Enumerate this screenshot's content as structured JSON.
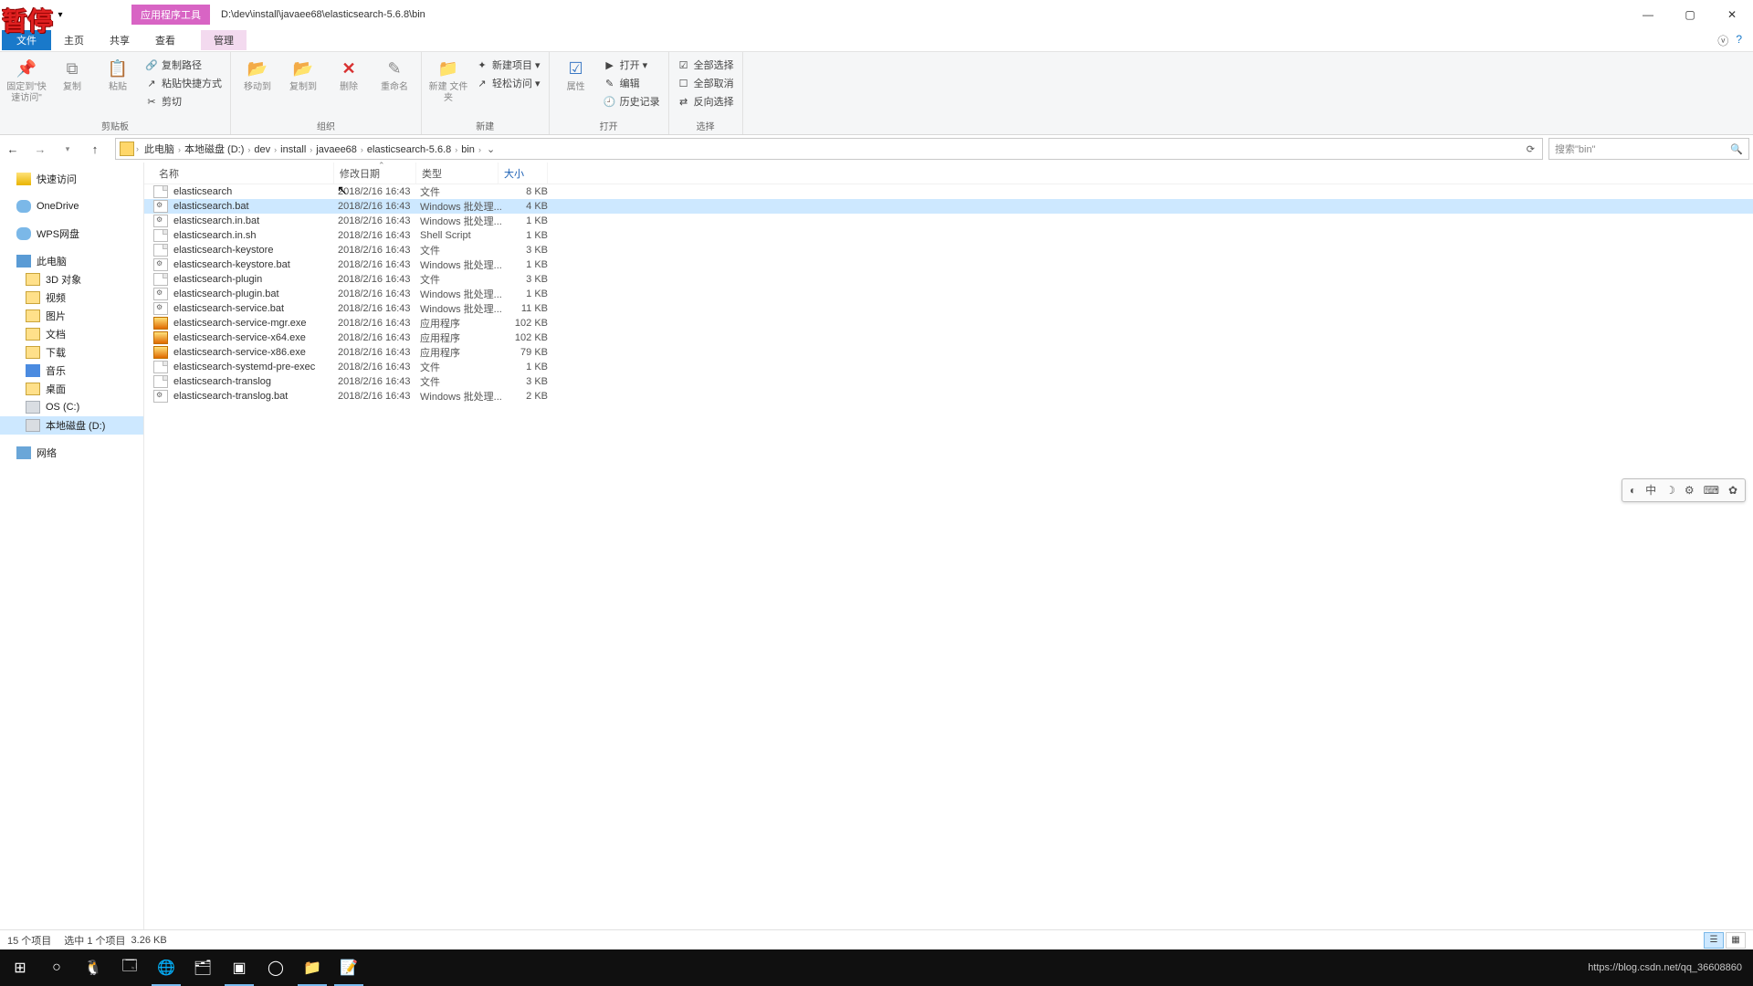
{
  "watermark": "暂停",
  "title_path": "D:\\dev\\install\\javaee68\\elasticsearch-5.6.8\\bin",
  "context_tab": "应用程序工具",
  "tabs": {
    "file": "文件",
    "home": "主页",
    "share": "共享",
    "view": "查看",
    "manage": "管理"
  },
  "ribbon": {
    "clipboard": {
      "pin": "固定到\"快\n速访问\"",
      "copy": "复制",
      "paste": "粘贴",
      "copy_path": "复制路径",
      "paste_shortcut": "粘贴快捷方式",
      "cut": "剪切",
      "label": "剪贴板"
    },
    "organize": {
      "moveto": "移动到",
      "copyto": "复制到",
      "delete": "删除",
      "rename": "重命名",
      "label": "组织"
    },
    "new": {
      "newfolder": "新建\n文件夹",
      "newitem": "新建项目 ▾",
      "easy": "轻松访问 ▾",
      "label": "新建"
    },
    "open": {
      "props": "属性",
      "open": "打开 ▾",
      "edit": "编辑",
      "history": "历史记录",
      "label": "打开"
    },
    "select": {
      "all": "全部选择",
      "none": "全部取消",
      "invert": "反向选择",
      "label": "选择"
    }
  },
  "breadcrumbs": [
    "此电脑",
    "本地磁盘 (D:)",
    "dev",
    "install",
    "javaee68",
    "elasticsearch-5.6.8",
    "bin"
  ],
  "search_placeholder": "搜索\"bin\"",
  "columns": {
    "name": "名称",
    "date": "修改日期",
    "type": "类型",
    "size": "大小"
  },
  "sidebar": [
    {
      "label": "快速访问",
      "icon": "ti-star",
      "depth": 0
    },
    {
      "gap": true
    },
    {
      "label": "OneDrive",
      "icon": "ti-cloud",
      "depth": 0
    },
    {
      "gap": true
    },
    {
      "label": "WPS网盘",
      "icon": "ti-cloud",
      "depth": 0
    },
    {
      "gap": true
    },
    {
      "label": "此电脑",
      "icon": "ti-pc",
      "depth": 0
    },
    {
      "label": "3D 对象",
      "icon": "ti-folder",
      "depth": 1
    },
    {
      "label": "视频",
      "icon": "ti-folder",
      "depth": 1
    },
    {
      "label": "图片",
      "icon": "ti-folder",
      "depth": 1
    },
    {
      "label": "文档",
      "icon": "ti-folder",
      "depth": 1
    },
    {
      "label": "下载",
      "icon": "ti-folder",
      "depth": 1
    },
    {
      "label": "音乐",
      "icon": "ti-music",
      "depth": 1
    },
    {
      "label": "桌面",
      "icon": "ti-folder",
      "depth": 1
    },
    {
      "label": "OS (C:)",
      "icon": "ti-drive",
      "depth": 1
    },
    {
      "label": "本地磁盘 (D:)",
      "icon": "ti-drive",
      "depth": 1,
      "selected": true
    },
    {
      "gap": true
    },
    {
      "label": "网络",
      "icon": "ti-net",
      "depth": 0
    }
  ],
  "files": [
    {
      "name": "elasticsearch",
      "date": "2018/2/16 16:43",
      "type": "文件",
      "size": "8 KB",
      "icon": "fi-file"
    },
    {
      "name": "elasticsearch.bat",
      "date": "2018/2/16 16:43",
      "type": "Windows 批处理...",
      "size": "4 KB",
      "icon": "fi-bat",
      "selected": true
    },
    {
      "name": "elasticsearch.in.bat",
      "date": "2018/2/16 16:43",
      "type": "Windows 批处理...",
      "size": "1 KB",
      "icon": "fi-bat"
    },
    {
      "name": "elasticsearch.in.sh",
      "date": "2018/2/16 16:43",
      "type": "Shell Script",
      "size": "1 KB",
      "icon": "fi-file"
    },
    {
      "name": "elasticsearch-keystore",
      "date": "2018/2/16 16:43",
      "type": "文件",
      "size": "3 KB",
      "icon": "fi-file"
    },
    {
      "name": "elasticsearch-keystore.bat",
      "date": "2018/2/16 16:43",
      "type": "Windows 批处理...",
      "size": "1 KB",
      "icon": "fi-bat"
    },
    {
      "name": "elasticsearch-plugin",
      "date": "2018/2/16 16:43",
      "type": "文件",
      "size": "3 KB",
      "icon": "fi-file"
    },
    {
      "name": "elasticsearch-plugin.bat",
      "date": "2018/2/16 16:43",
      "type": "Windows 批处理...",
      "size": "1 KB",
      "icon": "fi-bat"
    },
    {
      "name": "elasticsearch-service.bat",
      "date": "2018/2/16 16:43",
      "type": "Windows 批处理...",
      "size": "11 KB",
      "icon": "fi-bat"
    },
    {
      "name": "elasticsearch-service-mgr.exe",
      "date": "2018/2/16 16:43",
      "type": "应用程序",
      "size": "102 KB",
      "icon": "fi-exe"
    },
    {
      "name": "elasticsearch-service-x64.exe",
      "date": "2018/2/16 16:43",
      "type": "应用程序",
      "size": "102 KB",
      "icon": "fi-exe"
    },
    {
      "name": "elasticsearch-service-x86.exe",
      "date": "2018/2/16 16:43",
      "type": "应用程序",
      "size": "79 KB",
      "icon": "fi-exe"
    },
    {
      "name": "elasticsearch-systemd-pre-exec",
      "date": "2018/2/16 16:43",
      "type": "文件",
      "size": "1 KB",
      "icon": "fi-file"
    },
    {
      "name": "elasticsearch-translog",
      "date": "2018/2/16 16:43",
      "type": "文件",
      "size": "3 KB",
      "icon": "fi-file"
    },
    {
      "name": "elasticsearch-translog.bat",
      "date": "2018/2/16 16:43",
      "type": "Windows 批处理...",
      "size": "2 KB",
      "icon": "fi-bat"
    }
  ],
  "status": {
    "count": "15 个项目",
    "selected": "选中 1 个项目",
    "size": "3.26 KB"
  },
  "tray_url": "https://blog.csdn.net/qq_36608860",
  "ime": [
    "◐",
    "中",
    "☽",
    "⚙",
    "⌨",
    "✿"
  ]
}
